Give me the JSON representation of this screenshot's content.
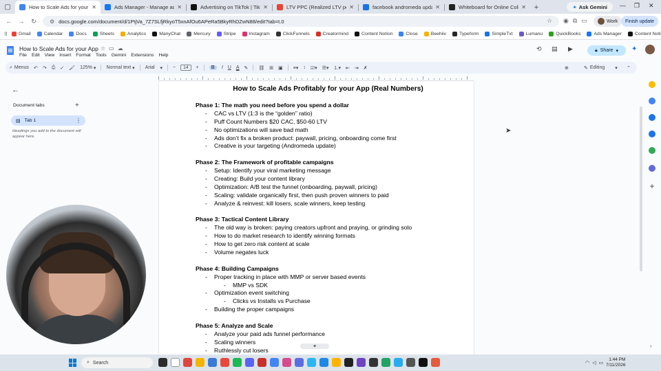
{
  "browser": {
    "tabs": [
      {
        "title": "How to Scale Ads for your App",
        "active": true,
        "color": "#4285f4"
      },
      {
        "title": "Ads Manager - Manage ads - C",
        "active": false,
        "color": "#1877f2"
      },
      {
        "title": "Advertising on TikTok | TikTok",
        "active": false,
        "color": "#111111"
      },
      {
        "title": "LTV PPC (Realized LTV per Pay",
        "active": false,
        "color": "#ea4335"
      },
      {
        "title": "facebook andromeda update -",
        "active": false,
        "color": "#1a73e8"
      },
      {
        "title": "Whiteboard for Online Collabo",
        "active": false,
        "color": "#222222"
      }
    ],
    "ask_gemini": "Ask Gemini",
    "url": "docs.google.com/document/d/1PtjVa_7Z7SLfjRkyoT5xnAfOu6APeRa5BkyRhDZwN88/edit?tab=t.0",
    "profile": "Work",
    "finish_update": "Finish update",
    "bookmarks": [
      {
        "label": "Gmail",
        "color": "#ea4335"
      },
      {
        "label": "Calendar",
        "color": "#4285f4"
      },
      {
        "label": "Docs",
        "color": "#4285f4"
      },
      {
        "label": "Sheets",
        "color": "#0f9d58"
      },
      {
        "label": "Analytics",
        "color": "#f9ab00"
      },
      {
        "label": "ManyChat",
        "color": "#111111"
      },
      {
        "label": "Mercury",
        "color": "#5f6368"
      },
      {
        "label": "Stripe",
        "color": "#635bff"
      },
      {
        "label": "Instagram",
        "color": "#e1306c"
      },
      {
        "label": "ClickFunnels",
        "color": "#333333"
      },
      {
        "label": "Creatormind",
        "color": "#d93025"
      },
      {
        "label": "Content Notion",
        "color": "#111111"
      },
      {
        "label": "Close",
        "color": "#3b82f6"
      },
      {
        "label": "Beehiiv",
        "color": "#f4b400"
      },
      {
        "label": "Typeform",
        "color": "#262627"
      },
      {
        "label": "SimpleTxt",
        "color": "#1a73e8"
      },
      {
        "label": "Lumanu",
        "color": "#6a5acd"
      },
      {
        "label": "QuickBooks",
        "color": "#2ca01c"
      },
      {
        "label": "Ads Manager",
        "color": "#1877f2"
      },
      {
        "label": "Content Notion",
        "color": "#111111"
      }
    ]
  },
  "docs": {
    "title": "How to Scale Ads for your App",
    "menu": [
      "File",
      "Edit",
      "View",
      "Insert",
      "Format",
      "Tools",
      "Gemini",
      "Extensions",
      "Help"
    ],
    "share_label": "Share",
    "toolbar": {
      "menus": "Menus",
      "zoom": "125%",
      "style": "Normal text",
      "font": "Arial",
      "font_size": "14",
      "mode": "Editing"
    },
    "left_panel": {
      "doc_tabs": "Document tabs",
      "tab1": "Tab 1",
      "hint": "Headings you add to the document will appear here."
    }
  },
  "document": {
    "heading": "How to Scale Ads Profitably for your App (Real Numbers)",
    "phases": [
      {
        "title": "Phase 1: The math you need before you spend a dollar",
        "items": [
          {
            "text": "CAC vs LTV (1:3 is the “golden” ratio)",
            "level": 1
          },
          {
            "text": "Puff Count Numbers $20 CAC, $50-60 LTV",
            "level": 1
          },
          {
            "text": "No optimizations will save bad math",
            "level": 1
          },
          {
            "text": "Ads don’t fix a broken product: paywall, pricing, onboarding come first",
            "level": 1
          },
          {
            "text": "Creative is your targeting (Andromeda update)",
            "level": 1
          }
        ]
      },
      {
        "title": "Phase 2: The Framework of profitable campaigns",
        "items": [
          {
            "text": "Setup: Identify your viral marketing message",
            "level": 1
          },
          {
            "text": "Creating: Build your content library",
            "level": 1
          },
          {
            "text": "Optimization: A/B test the funnel (onboarding, paywall, pricing)",
            "level": 1
          },
          {
            "text": "Scaling: validate organically first, then push proven winners to paid",
            "level": 1
          },
          {
            "text": "Analyze & reinvest: kill losers, scale winners, keep testing",
            "level": 1
          }
        ]
      },
      {
        "title": "Phase 3: Tactical Content Library",
        "items": [
          {
            "text": "The old way is broken: paying creators upfront and praying, or grinding solo",
            "level": 1
          },
          {
            "text": "How to do market research to identify winning formats",
            "level": 1
          },
          {
            "text": "How to get zero risk content at scale",
            "level": 1
          },
          {
            "text": "Volume negates luck",
            "level": 1
          }
        ]
      },
      {
        "title": "Phase 4: Building Campaigns",
        "items": [
          {
            "text": "Proper tracking in place with MMP or server based events",
            "level": 1
          },
          {
            "text": "MMP vs SDK",
            "level": 2
          },
          {
            "text": "Optimization event switching",
            "level": 1
          },
          {
            "text": "Clicks vs Installs vs Purchase",
            "level": 2
          },
          {
            "text": "Building the proper campaigns",
            "level": 1
          }
        ]
      },
      {
        "title": "Phase 5: Analyze and Scale",
        "items": [
          {
            "text": "Analyze your paid ads funnel performance",
            "level": 1
          },
          {
            "text": "Scaling winners",
            "level": 1
          },
          {
            "text": "Ruthlessly cut losers",
            "level": 1
          }
        ]
      }
    ]
  },
  "taskbar": {
    "search": "Search",
    "time": "1:44 PM",
    "date": "7/11/2026"
  }
}
